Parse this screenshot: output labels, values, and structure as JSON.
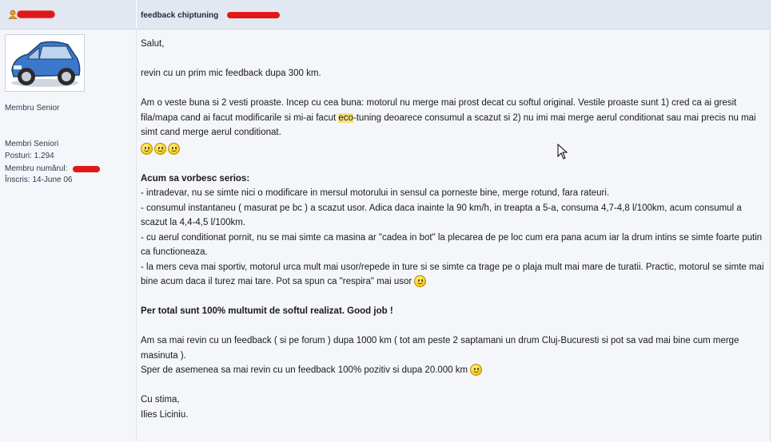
{
  "header": {
    "post_title": "feedback chiptuning"
  },
  "user": {
    "rank": "Membru Senior",
    "group": "Membri Seniori",
    "posts": "Posturi: 1.294",
    "member_number_label": "Membru numărul:",
    "joined": "Înscris: 14-June 06"
  },
  "icons": [
    "user-icon",
    "avatar-car",
    "smiley-icon",
    "cursor-icon"
  ],
  "post": {
    "greeting": "Salut,",
    "intro": "revin cu un prim mic feedback dupa 300 km.",
    "news_before": "Am o veste buna si 2 vesti proaste. Incep cu cea buna: motorul nu merge mai prost decat cu softul original. Vestile proaste sunt 1) cred ca ai gresit fila/mapa cand ai facut modificarile si mi-ai facut ",
    "news_highlight": "eco",
    "news_after": "-tuning deoarece consumul a scazut si 2) nu imi mai merge aerul conditionat sau mai precis nu mai simt cand merge aerul conditionat.",
    "serious_heading": "Acum sa vorbesc serios:",
    "serious_1": "- intradevar, nu se simte nici o modificare in mersul motorului in sensul ca porneste bine, merge rotund, fara rateuri.",
    "serious_2": "- consumul instantaneu ( masurat pe bc ) a scazut usor. Adica daca inainte la 90 km/h, in treapta a 5-a, consuma 4,7-4,8 l/100km, acum consumul a scazut la 4,4-4,5 l/100km.",
    "serious_3": "- cu aerul conditionat pornit, nu se mai simte ca masina ar \"cadea in bot\" la plecarea de pe loc cum era pana acum iar la drum intins se simte foarte putin ca functioneaza.",
    "serious_4": "- la mers ceva mai sportiv, motorul urca mult mai usor/repede in ture si se simte ca trage pe o plaja mult mai mare de turatii. Practic, motorul se simte mai bine acum daca il turez mai tare. Pot sa spun ca \"respira\" mai usor",
    "total": "Per total sunt 100% multumit de softul realizat. Good job !",
    "later_1": "Am sa mai revin cu un feedback ( si pe forum ) dupa 1000 km ( tot am peste 2 saptamani un drum Cluj-Bucuresti si pot sa vad mai bine cum merge masinuta ).",
    "later_2": "Sper de asemenea sa mai revin cu un feedback 100% pozitiv si dupa 20.000 km",
    "closing": "Cu stima,",
    "signature": "Ilies Liciniu."
  }
}
